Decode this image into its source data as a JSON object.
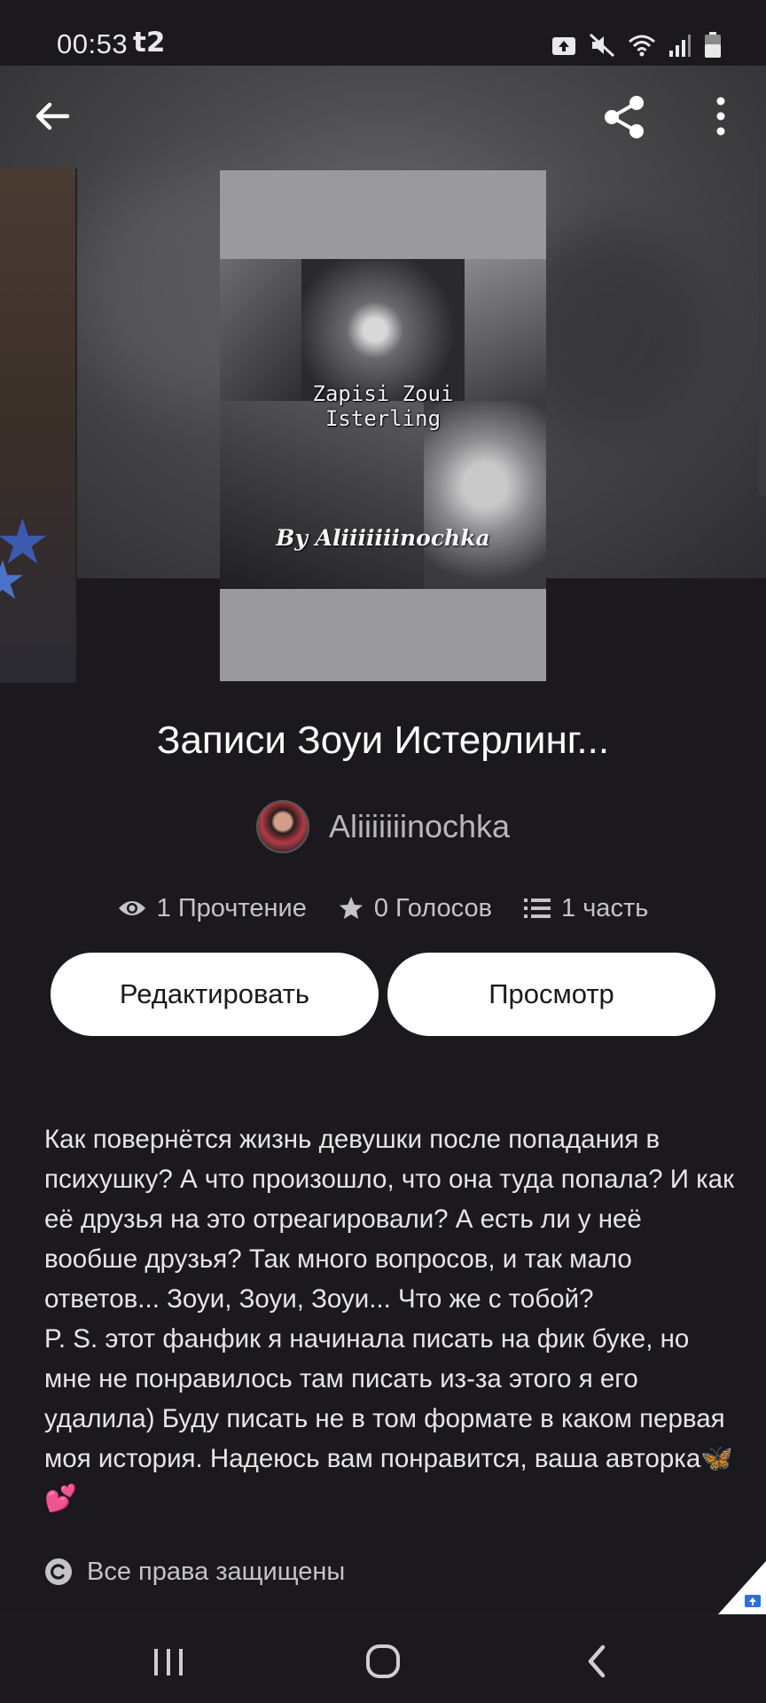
{
  "status_bar": {
    "time": "00:53",
    "carrier": "t2"
  },
  "cover": {
    "title_line1": "Zapisi Zoui",
    "title_line2": "Isterling",
    "byline": "By Aliiiiiiinochka"
  },
  "story": {
    "title": "Записи Зоуи Истерлинг...",
    "author": "Aliiiiiiinochka",
    "stats": {
      "reads": "1 Прочтение",
      "votes": "0 Голосов",
      "parts": "1 часть"
    },
    "buttons": {
      "edit": "Редактировать",
      "preview": "Просмотр"
    },
    "description": "Как повернётся жизнь девушки после попадания в психушку? А что произошло, что она туда попала? И как её друзья на это отреагировали? А есть ли у неё вообше друзья? Так много вопросов, и так мало ответов... Зоуи, Зоуи, Зоуи... Что же с тобой?\nP. S. этот фанфик я начинала писать на фик буке, но мне не понравилось там писать из-за этого я его удалила) Буду писать не в том формате в каком первая моя история. Надеюсь вам понравится, ваша авторка🦋💕",
    "copyright": "Все права защищены"
  },
  "icons": {
    "back": "arrow-left-icon",
    "share": "share-icon",
    "more": "more-vertical-icon",
    "reads": "eye-icon",
    "votes": "star-icon",
    "parts": "list-icon",
    "copyright": "copyright-icon"
  },
  "colors": {
    "background": "#1b191e",
    "button_bg": "#ffffff",
    "button_text": "#1b191e",
    "muted_text": "#c4c4c4"
  }
}
